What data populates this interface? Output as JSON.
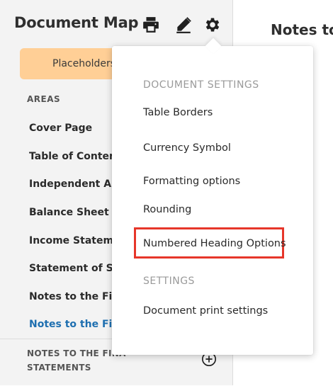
{
  "sidebar": {
    "title": "Document Map",
    "placeholders_label": "Placeholders",
    "areas_heading": "AREAS",
    "items": [
      {
        "label": "Cover Page"
      },
      {
        "label": "Table of Contents"
      },
      {
        "label": "Independent Aud"
      },
      {
        "label": "Balance Sheet"
      },
      {
        "label": "Income Statemen"
      },
      {
        "label": "Statement of Sto"
      },
      {
        "label": "Notes to the Fina"
      },
      {
        "label": "Notes to the Fina"
      }
    ],
    "notes_section_label": "NOTES TO THE FINA STATEMENTS"
  },
  "toolbar": {
    "icons": [
      "printer-icon",
      "pen-icon",
      "gear-icon"
    ]
  },
  "main": {
    "title": "Notes to"
  },
  "settings_menu": {
    "document_settings_heading": "DOCUMENT SETTINGS",
    "document_items": [
      {
        "label": "Table Borders"
      },
      {
        "label": "Currency Symbol"
      },
      {
        "label": "Formatting options"
      },
      {
        "label": "Rounding"
      },
      {
        "label": "Numbered Heading Options"
      }
    ],
    "settings_heading": "SETTINGS",
    "settings_items": [
      {
        "label": "Document print settings"
      }
    ]
  },
  "colors": {
    "accent_orange": "#ffcf96",
    "active_link": "#1e6fb0",
    "highlight_red": "#e6362a"
  }
}
